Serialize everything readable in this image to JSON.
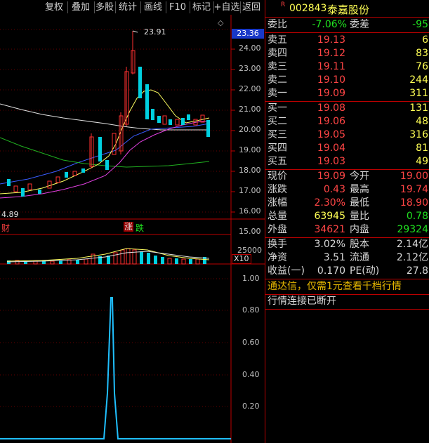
{
  "toolbar": [
    "复权",
    "叠加",
    "多股",
    "统计",
    "画线",
    "F10",
    "标记",
    "+自选",
    "返回"
  ],
  "stock": {
    "badge": "R",
    "code": "002843",
    "name": "泰嘉股份"
  },
  "price_axis": [
    "24.00",
    "23.00",
    "22.00",
    "21.00",
    "20.00",
    "19.00",
    "18.00",
    "17.00",
    "16.00",
    "15.00"
  ],
  "current_price_tag": "23.36",
  "high_marker": "23.91",
  "low_marker": "4.89",
  "markers": {
    "cai": "财",
    "zhang": "涨",
    "die": "跌"
  },
  "vol_axis": "25000",
  "vol_unit": "X10",
  "ind_axis": [
    "1.00",
    "0.80",
    "0.60",
    "0.40",
    "0.20"
  ],
  "weibi": {
    "label": "委比",
    "value": "-7.06%",
    "label2": "委差",
    "value2": "-95"
  },
  "sells": [
    {
      "label": "卖五",
      "price": "19.13",
      "vol": "6"
    },
    {
      "label": "卖四",
      "price": "19.12",
      "vol": "83"
    },
    {
      "label": "卖三",
      "price": "19.11",
      "vol": "76"
    },
    {
      "label": "卖二",
      "price": "19.10",
      "vol": "244"
    },
    {
      "label": "卖一",
      "price": "19.09",
      "vol": "311"
    }
  ],
  "buys": [
    {
      "label": "买一",
      "price": "19.08",
      "vol": "131"
    },
    {
      "label": "买二",
      "price": "19.06",
      "vol": "48"
    },
    {
      "label": "买三",
      "price": "19.05",
      "vol": "316"
    },
    {
      "label": "买四",
      "price": "19.04",
      "vol": "81"
    },
    {
      "label": "买五",
      "price": "19.03",
      "vol": "49"
    }
  ],
  "quote": [
    {
      "l1": "现价",
      "v1": "19.09",
      "l2": "今开",
      "v2": "19.00"
    },
    {
      "l1": "涨跌",
      "v1": "0.43",
      "l2": "最高",
      "v2": "19.74"
    },
    {
      "l1": "涨幅",
      "v1": "2.30%",
      "l2": "最低",
      "v2": "18.90"
    },
    {
      "l1": "总量",
      "v1": "63945",
      "l2": "量比",
      "v2": "0.78"
    },
    {
      "l1": "外盘",
      "v1": "34621",
      "l2": "内盘",
      "v2": "29324"
    }
  ],
  "fin": [
    {
      "l1": "换手",
      "v1": "3.02%",
      "l2": "股本",
      "v2": "2.14亿"
    },
    {
      "l1": "净资",
      "v1": "3.51",
      "l2": "流通",
      "v2": "2.12亿"
    },
    {
      "l1": "收益(一)",
      "v1": "0.170",
      "l2": "PE(动)",
      "v2": "27.8"
    }
  ],
  "notice": "通达信，仅需1元查看千档行情",
  "status": "行情连接已断开"
}
